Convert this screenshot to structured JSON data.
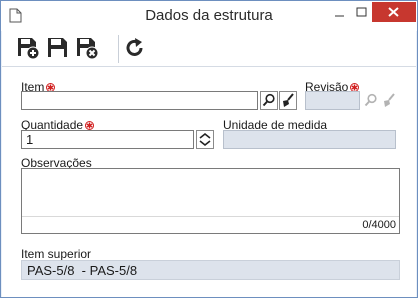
{
  "window": {
    "title": "Dados da estrutura",
    "icon": "document-icon",
    "controls": [
      "minimize-icon",
      "maximize-icon",
      "close-icon"
    ],
    "close_color": "#c7372f"
  },
  "toolbar": {
    "buttons": [
      {
        "name": "save-new-button",
        "icon": "floppy-plus-icon"
      },
      {
        "name": "save-button",
        "icon": "floppy-icon"
      },
      {
        "name": "save-close-button",
        "icon": "floppy-x-icon"
      },
      {
        "name": "refresh-button",
        "icon": "refresh-icon"
      }
    ]
  },
  "form": {
    "item": {
      "label": "Item",
      "value": "",
      "required": true,
      "icons": [
        "search-icon",
        "clear-brush-icon"
      ]
    },
    "revisao": {
      "label": "Revisão",
      "value": "",
      "required": true,
      "disabled": true,
      "icons": [
        "search-icon",
        "clear-brush-icon"
      ]
    },
    "quantidade": {
      "label": "Quantidade",
      "value": "1",
      "required": true,
      "icons": [
        "spinner-icon"
      ]
    },
    "unidade": {
      "label": "Unidade de medida",
      "value": "",
      "disabled": true
    },
    "observacoes": {
      "label": "Observações",
      "value": "",
      "counter": "0/4000"
    },
    "item_superior": {
      "label": "Item superior",
      "value": "PAS-5/8  - PAS-5/8"
    }
  },
  "colors": {
    "required": "#d11f1f",
    "accent": "#2f6fc7"
  }
}
